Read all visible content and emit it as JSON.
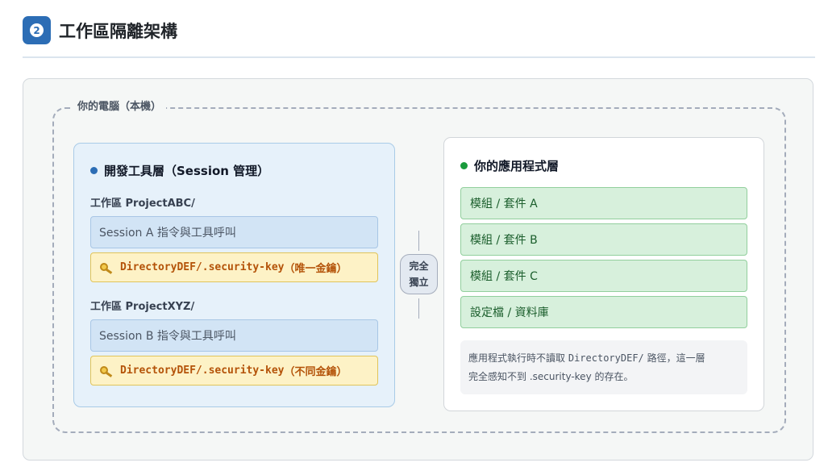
{
  "header": {
    "badge": "2",
    "title": "工作區隔離架構"
  },
  "machine": {
    "label": "你的電腦（本機）"
  },
  "dev_panel": {
    "title": "開發工具層（Session 管理）",
    "dot_color": "#2c6db5",
    "workspaces": [
      {
        "label": "工作區 ProjectABC/",
        "session": "Session A 指令與工具呼叫",
        "key_path": "DirectoryDEF/.security-key",
        "key_note": "（唯一金鑰）"
      },
      {
        "label": "工作區 ProjectXYZ/",
        "session": "Session B 指令與工具呼叫",
        "key_path": "DirectoryDEF/.security-key",
        "key_note": "（不同金鑰）"
      }
    ]
  },
  "separator": {
    "line1": "完全",
    "line2": "獨立"
  },
  "app_panel": {
    "title": "你的應用程式層",
    "dot_color": "#1a9b3c",
    "modules": [
      "模組 / 套件 A",
      "模組 / 套件 B",
      "模組 / 套件 C",
      "設定檔 / 資料庫"
    ],
    "note": {
      "part1": "應用程式執行時不讀取",
      "path": "DirectoryDEF/",
      "part2": "路徑，這一層",
      "line2": "完全感知不到 .security-key 的存在。"
    }
  },
  "icons": {
    "badge": "number-badge",
    "key": "key-icon",
    "dot": "status-dot"
  },
  "colors": {
    "accent": "#2c6db5",
    "key_text": "#b45309",
    "module_text": "#1b5e2c"
  }
}
